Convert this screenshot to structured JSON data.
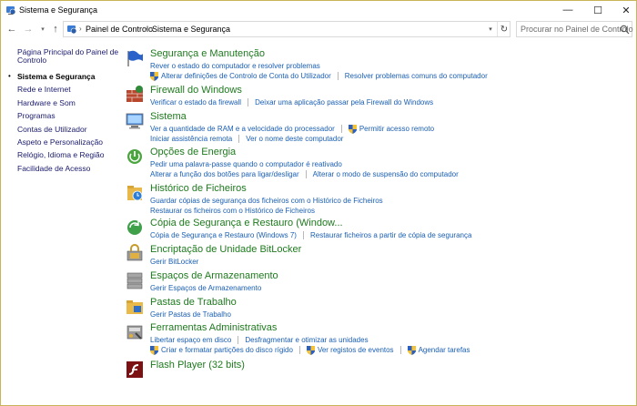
{
  "window": {
    "title": "Sistema e Segurança",
    "min_glyph": "—",
    "max_glyph": "☐",
    "close_glyph": "✕"
  },
  "nav": {
    "back_glyph": "←",
    "forward_glyph": "→",
    "dropdown_glyph": "▾",
    "up_glyph": "↑",
    "breadcrumb": [
      "Painel de Controlo",
      "Sistema e Segurança"
    ],
    "crumb_sep": "›",
    "refresh_glyph": "↻",
    "search_placeholder": "Procurar no Painel de Controlo"
  },
  "sidebar": {
    "home_line1": "Página Principal do Painel de",
    "home_line2": "Controlo",
    "bullet": "•",
    "items": [
      {
        "label": "Sistema e Segurança",
        "current": true
      },
      {
        "label": "Rede e Internet"
      },
      {
        "label": "Hardware e Som"
      },
      {
        "label": "Programas"
      },
      {
        "label": "Contas de Utilizador"
      },
      {
        "label": "Aspeto e Personalização"
      },
      {
        "label": "Relógio, Idioma e Região"
      },
      {
        "label": "Facilidade de Acesso"
      }
    ]
  },
  "categories": [
    {
      "title": "Segurança e Manutenção",
      "icon": "flag-icon",
      "lines": [
        [
          "Rever o estado do computador e resolver problemas"
        ],
        [
          "*Alterar definições de Controlo de Conta do Utilizador",
          "Resolver problemas comuns do computador"
        ]
      ]
    },
    {
      "title": "Firewall do Windows",
      "icon": "firewall-icon",
      "lines": [
        [
          "Verificar o estado da firewall",
          "Deixar uma aplicação passar pela Firewall do Windows"
        ]
      ]
    },
    {
      "title": "Sistema",
      "icon": "computer-icon",
      "lines": [
        [
          "Ver a quantidade de RAM e a velocidade do processador",
          "*Permitir acesso remoto"
        ],
        [
          "Iniciar assistência remota",
          "Ver o nome deste computador"
        ]
      ]
    },
    {
      "title": "Opções de Energia",
      "icon": "power-options-icon",
      "lines": [
        [
          "Pedir uma palavra-passe quando o computador é reativado"
        ],
        [
          "Alterar a função dos botões para ligar/desligar",
          "Alterar o modo de suspensão do computador"
        ]
      ]
    },
    {
      "title": "Histórico de Ficheiros",
      "icon": "file-history-icon",
      "lines": [
        [
          "Guardar cópias de segurança dos ficheiros com o Histórico de Ficheiros"
        ],
        [
          "Restaurar os ficheiros com o Histórico de Ficheiros"
        ]
      ]
    },
    {
      "title": "Cópia de Segurança e Restauro (Window...",
      "icon": "backup-restore-icon",
      "lines": [
        [
          "Cópia de Segurança e Restauro (Windows 7)",
          "Restaurar ficheiros a partir de cópia de segurança"
        ]
      ]
    },
    {
      "title": "Encriptação de Unidade BitLocker",
      "icon": "bitlocker-icon",
      "lines": [
        [
          "Gerir BitLocker"
        ]
      ]
    },
    {
      "title": "Espaços de Armazenamento",
      "icon": "storage-spaces-icon",
      "lines": [
        [
          "Gerir Espaços de Armazenamento"
        ]
      ]
    },
    {
      "title": "Pastas de Trabalho",
      "icon": "work-folders-icon",
      "lines": [
        [
          "Gerir Pastas de Trabalho"
        ]
      ]
    },
    {
      "title": "Ferramentas Administrativas",
      "icon": "admin-tools-icon",
      "lines": [
        [
          "Libertar espaço em disco",
          "Desfragmentar e otimizar as unidades"
        ],
        [
          "*Criar e formatar partições do disco rígido",
          "*Ver registos de eventos",
          "*Agendar tarefas"
        ]
      ]
    },
    {
      "title": "Flash Player (32 bits)",
      "icon": "flash-player-icon",
      "lines": []
    }
  ]
}
